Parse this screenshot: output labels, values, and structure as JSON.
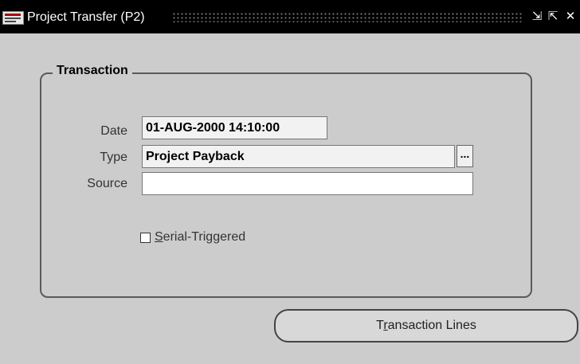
{
  "window": {
    "title": "Project Transfer (P2)",
    "minimize_glyph": "⇲",
    "maximize_glyph": "⇱",
    "close_glyph": "✕"
  },
  "transaction": {
    "group_title": "Transaction",
    "date_label": "Date",
    "date_value": "01-AUG-2000 14:10:00",
    "type_label": "Type",
    "type_value": "Project Payback",
    "lov_button": "...",
    "source_label": "Source",
    "source_value": "",
    "serial_triggered_mnemonic": "S",
    "serial_triggered_rest": "erial-Triggered",
    "serial_triggered_checked": false
  },
  "buttons": {
    "transaction_lines_pre": "T",
    "transaction_lines_mnemonic": "r",
    "transaction_lines_rest": "ansaction Lines"
  },
  "icons": [
    "oracle-app-icon",
    "minimize-icon",
    "maximize-icon",
    "close-icon"
  ]
}
